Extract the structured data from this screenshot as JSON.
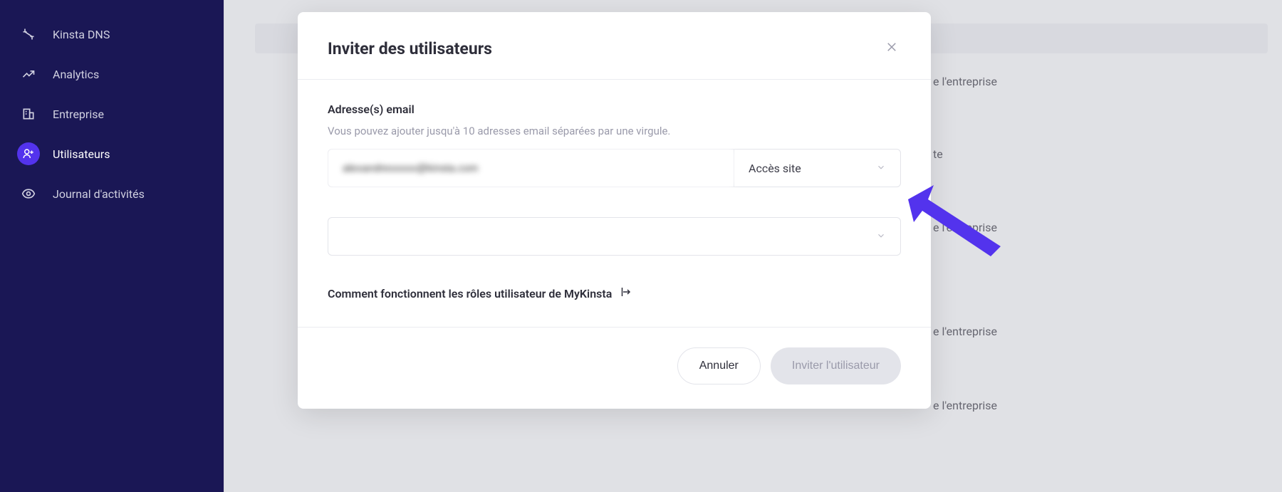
{
  "sidebar": {
    "items": [
      {
        "label": "Kinsta DNS",
        "icon": "dns-icon"
      },
      {
        "label": "Analytics",
        "icon": "analytics-icon"
      },
      {
        "label": "Entreprise",
        "icon": "building-icon"
      },
      {
        "label": "Utilisateurs",
        "icon": "user-plus-icon"
      },
      {
        "label": "Journal d'activités",
        "icon": "eye-icon"
      }
    ]
  },
  "background": {
    "labels": [
      "e l'entreprise",
      "te",
      "e l'entreprise",
      "e l'entreprise",
      "e l'entreprise"
    ]
  },
  "modal": {
    "title": "Inviter des utilisateurs",
    "email_label": "Adresse(s) email",
    "email_help": "Vous pouvez ajouter jusqu'à 10 adresses email séparées par une virgule.",
    "email_value": "alexandrexxxxx@kinsta.com",
    "access_select_value": "Accès site",
    "help_link": "Comment fonctionnent les rôles utilisateur de MyKinsta",
    "cancel_button": "Annuler",
    "invite_button": "Inviter l'utilisateur"
  }
}
